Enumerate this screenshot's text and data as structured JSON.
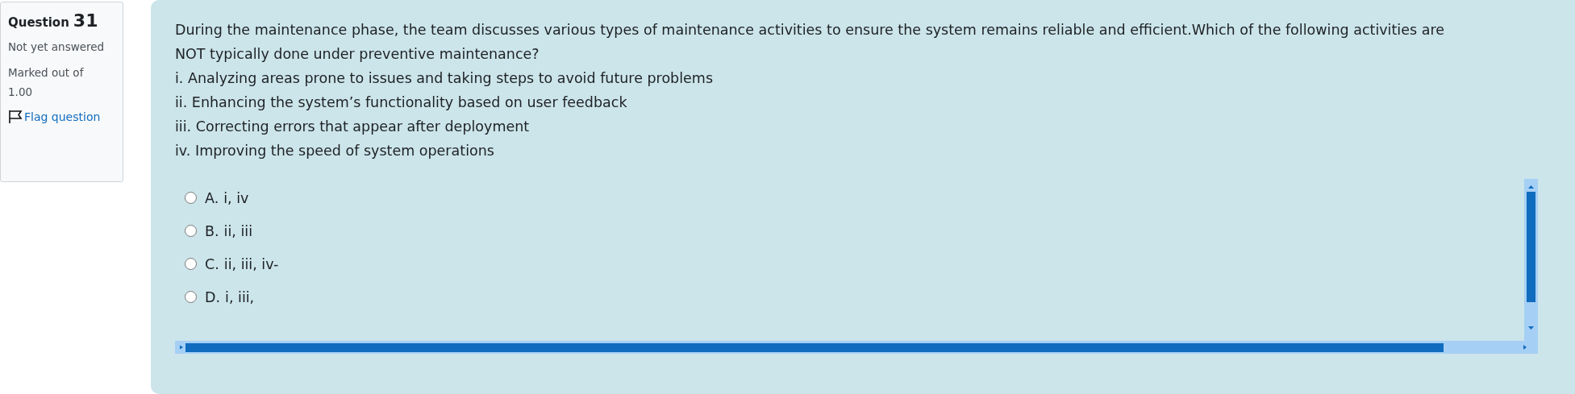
{
  "info": {
    "label": "Question",
    "number": "31",
    "status": "Not yet answered",
    "marks": "Marked out of 1.00",
    "flag": {
      "label": "Flag question",
      "flagged": false
    }
  },
  "question": {
    "text": "During the maintenance phase, the team discusses various types of maintenance activities to ensure the system remains reliable and efficient.Which of the following activities are NOT typically done under preventive maintenance?",
    "statements": [
      "i. Analyzing areas prone to issues and taking steps to avoid future problems",
      "ii. Enhancing the system’s functionality based on user feedback",
      "iii. Correcting errors that appear after deployment",
      "iv. Improving the speed of system operations"
    ]
  },
  "options": [
    {
      "letter": "A.",
      "text": "i, iv",
      "selected": false
    },
    {
      "letter": "B.",
      "text": "ii, iii",
      "selected": false
    },
    {
      "letter": "C.",
      "text": "ii, iii, iv-",
      "selected": false
    },
    {
      "letter": "D.",
      "text": "i, iii,",
      "selected": false
    }
  ]
}
